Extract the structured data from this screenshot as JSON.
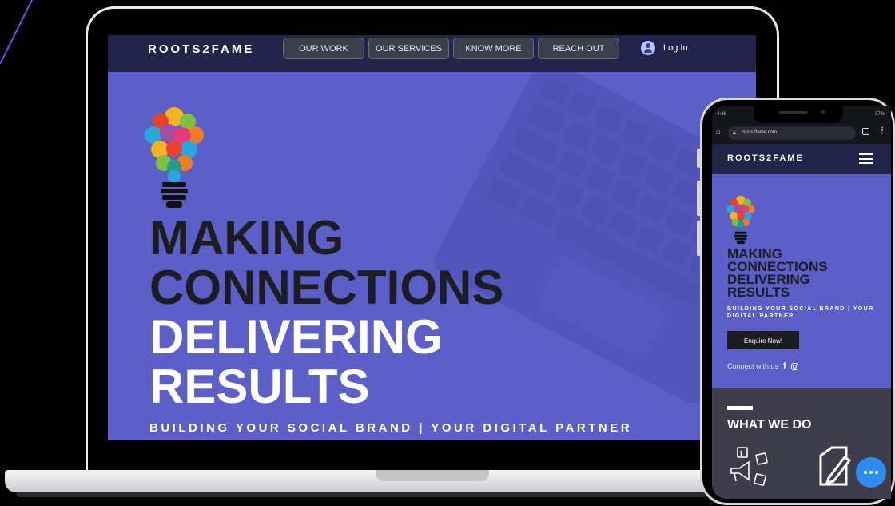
{
  "desktop": {
    "brand": "ROOTS2FAME",
    "nav": {
      "our_work": "OUR WORK",
      "our_services": "OUR SERVICES",
      "know_more": "KNOW MORE",
      "reach_out": "REACH OUT",
      "login": "Log In"
    },
    "hero": {
      "line1": "MAKING",
      "line2": "CONNECTIONS",
      "line3": "DELIVERING",
      "line4": "RESULTS"
    },
    "tagline": "BUILDING YOUR SOCIAL BRAND | YOUR DIGITAL PARTNER"
  },
  "mobile": {
    "status_left": "4:46",
    "status_right": "37%",
    "url": "roots2fame.com",
    "brand": "ROOTS2FAME",
    "hero": {
      "line1": "MAKING",
      "line2": "CONNECTIONS",
      "line3": "DELIVERING",
      "line4": "RESULTS"
    },
    "tagline": "BUILDING YOUR SOCIAL BRAND | YOUR DIGITAL PARTNER",
    "enquire": "Enquire Now!",
    "connect": "Connect with us",
    "section_title": "WHAT WE DO"
  },
  "colors": {
    "hero_bg": "#5b5fc7",
    "nav_bg": "#22244a",
    "accent_line": "#4c5cf0",
    "chat_button": "#2d8cf0"
  },
  "icons": [
    "lightbulb-icon",
    "user-icon",
    "hamburger-menu-icon",
    "facebook-icon",
    "instagram-icon",
    "social-megaphone-icon",
    "edit-document-icon",
    "chat-more-icon"
  ]
}
